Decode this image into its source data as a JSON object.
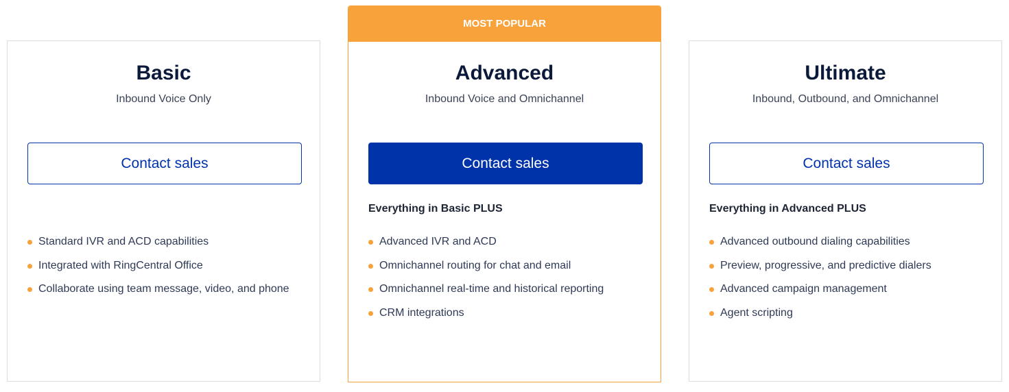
{
  "accent_color": "#f8a23c",
  "brand_color": "#0033aa",
  "plans": [
    {
      "name": "Basic",
      "subtitle": "Inbound Voice Only",
      "cta": "Contact sales",
      "features": [
        "Standard IVR and ACD capabilities",
        "Integrated with RingCentral Office",
        "Collaborate using team message, video, and phone"
      ]
    },
    {
      "badge": "MOST POPULAR",
      "name": "Advanced",
      "subtitle": "Inbound Voice and Omnichannel",
      "cta": "Contact sales",
      "includes": "Everything in Basic PLUS",
      "features": [
        "Advanced IVR and ACD",
        "Omnichannel routing for chat and email",
        "Omnichannel real-time and historical reporting",
        "CRM integrations"
      ]
    },
    {
      "name": "Ultimate",
      "subtitle": "Inbound, Outbound, and Omnichannel",
      "cta": "Contact sales",
      "includes": "Everything in Advanced PLUS",
      "features": [
        "Advanced outbound dialing capabilities",
        "Preview, progressive, and predictive dialers",
        "Advanced campaign management",
        "Agent scripting"
      ]
    }
  ]
}
